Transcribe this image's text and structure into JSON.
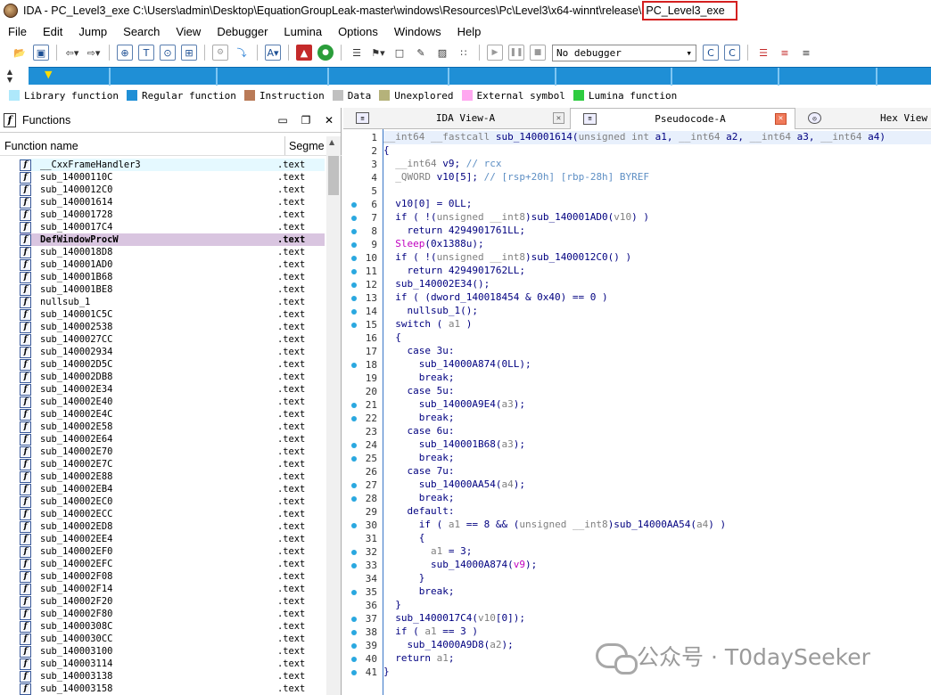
{
  "window": {
    "title_prefix": "IDA - PC_Level3_exe C:\\Users\\admin\\Desktop\\EquationGroupLeak-master\\windows\\Resources\\Pc\\Level3\\x64-winnt\\release\\",
    "title_highlight": "PC_Level3_exe"
  },
  "menu": [
    "File",
    "Edit",
    "Jump",
    "Search",
    "View",
    "Debugger",
    "Lumina",
    "Options",
    "Windows",
    "Help"
  ],
  "toolbar": {
    "debugger_select": "No debugger"
  },
  "legend": [
    {
      "label": "Library function",
      "color": "#aee8fb"
    },
    {
      "label": "Regular function",
      "color": "#1f8fd6"
    },
    {
      "label": "Instruction",
      "color": "#b97a57"
    },
    {
      "label": "Data",
      "color": "#c0c0c0"
    },
    {
      "label": "Unexplored",
      "color": "#b5b27a"
    },
    {
      "label": "External symbol",
      "color": "#ffa8f0"
    },
    {
      "label": "Lumina function",
      "color": "#2ecc40"
    }
  ],
  "functions_panel": {
    "title": "Functions",
    "col_name": "Function name",
    "col_segment": "Segme",
    "rows": [
      {
        "name": "__CxxFrameHandler3",
        "seg": ".text",
        "style": "lib"
      },
      {
        "name": "sub_14000110C",
        "seg": ".text"
      },
      {
        "name": "sub_1400012C0",
        "seg": ".text"
      },
      {
        "name": "sub_140001614",
        "seg": ".text"
      },
      {
        "name": "sub_140001728",
        "seg": ".text"
      },
      {
        "name": "sub_1400017C4",
        "seg": ".text"
      },
      {
        "name": "DefWindowProcW",
        "seg": ".text",
        "style": "sel"
      },
      {
        "name": "sub_1400018D8",
        "seg": ".text"
      },
      {
        "name": "sub_140001AD0",
        "seg": ".text"
      },
      {
        "name": "sub_140001B68",
        "seg": ".text"
      },
      {
        "name": "sub_140001BE8",
        "seg": ".text"
      },
      {
        "name": "nullsub_1",
        "seg": ".text"
      },
      {
        "name": "sub_140001C5C",
        "seg": ".text"
      },
      {
        "name": "sub_140002538",
        "seg": ".text"
      },
      {
        "name": "sub_1400027CC",
        "seg": ".text"
      },
      {
        "name": "sub_140002934",
        "seg": ".text"
      },
      {
        "name": "sub_140002D5C",
        "seg": ".text"
      },
      {
        "name": "sub_140002DB8",
        "seg": ".text"
      },
      {
        "name": "sub_140002E34",
        "seg": ".text"
      },
      {
        "name": "sub_140002E40",
        "seg": ".text"
      },
      {
        "name": "sub_140002E4C",
        "seg": ".text"
      },
      {
        "name": "sub_140002E58",
        "seg": ".text"
      },
      {
        "name": "sub_140002E64",
        "seg": ".text"
      },
      {
        "name": "sub_140002E70",
        "seg": ".text"
      },
      {
        "name": "sub_140002E7C",
        "seg": ".text"
      },
      {
        "name": "sub_140002E88",
        "seg": ".text"
      },
      {
        "name": "sub_140002EB4",
        "seg": ".text"
      },
      {
        "name": "sub_140002EC0",
        "seg": ".text"
      },
      {
        "name": "sub_140002ECC",
        "seg": ".text"
      },
      {
        "name": "sub_140002ED8",
        "seg": ".text"
      },
      {
        "name": "sub_140002EE4",
        "seg": ".text"
      },
      {
        "name": "sub_140002EF0",
        "seg": ".text"
      },
      {
        "name": "sub_140002EFC",
        "seg": ".text"
      },
      {
        "name": "sub_140002F08",
        "seg": ".text"
      },
      {
        "name": "sub_140002F14",
        "seg": ".text"
      },
      {
        "name": "sub_140002F20",
        "seg": ".text"
      },
      {
        "name": "sub_140002F80",
        "seg": ".text"
      },
      {
        "name": "sub_14000308C",
        "seg": ".text"
      },
      {
        "name": "sub_1400030CC",
        "seg": ".text"
      },
      {
        "name": "sub_140003100",
        "seg": ".text"
      },
      {
        "name": "sub_140003114",
        "seg": ".text"
      },
      {
        "name": "sub_140003138",
        "seg": ".text"
      },
      {
        "name": "sub_140003158",
        "seg": ".text"
      }
    ]
  },
  "tabs": [
    {
      "label": "IDA View-A",
      "active": false
    },
    {
      "label": "Pseudocode-A",
      "active": true
    },
    {
      "label": "Hex View",
      "active": false
    }
  ],
  "code_lines": [
    {
      "n": "1",
      "dot": false,
      "html": "<span class=\"gray\">__int64 __fastcall</span> sub_140001614(<span class=\"gray\">unsigned int</span> a1, <span class=\"gray\">__int64</span> a2, <span class=\"gray\">__int64</span> a3, <span class=\"gray\">__int64</span> a4)"
    },
    {
      "n": "2",
      "dot": false,
      "html": "{"
    },
    {
      "n": "3",
      "dot": false,
      "html": "  <span class=\"gray\">__int64</span> v9; <span class=\"cmt\">// rcx</span>"
    },
    {
      "n": "4",
      "dot": false,
      "html": "  <span class=\"gray\">_QWORD</span> v10[5]; <span class=\"cmt\">// [rsp+20h] [rbp-28h] BYREF</span>"
    },
    {
      "n": "5",
      "dot": false,
      "html": ""
    },
    {
      "n": "6",
      "dot": true,
      "html": "  v10[0] = 0LL;"
    },
    {
      "n": "7",
      "dot": true,
      "html": "  if ( !(<span class=\"gray\">unsigned __int8</span>)sub_140001AD0(<span class=\"gray\">v10</span>) )"
    },
    {
      "n": "8",
      "dot": true,
      "html": "    return 4294901761LL;"
    },
    {
      "n": "9",
      "dot": true,
      "html": "  <span class=\"pink\">Sleep</span>(0x1388u);"
    },
    {
      "n": "10",
      "dot": true,
      "html": "  if ( !(<span class=\"gray\">unsigned __int8</span>)sub_1400012C0() )"
    },
    {
      "n": "11",
      "dot": true,
      "html": "    return 4294901762LL;"
    },
    {
      "n": "12",
      "dot": true,
      "html": "  sub_140002E34();"
    },
    {
      "n": "13",
      "dot": true,
      "html": "  if ( (dword_140018454 & 0x40) == 0 )"
    },
    {
      "n": "14",
      "dot": true,
      "html": "    nullsub_1();"
    },
    {
      "n": "15",
      "dot": true,
      "html": "  switch ( <span class=\"gray\">a1</span> )"
    },
    {
      "n": "16",
      "dot": false,
      "html": "  {"
    },
    {
      "n": "17",
      "dot": false,
      "html": "    case 3u:"
    },
    {
      "n": "18",
      "dot": true,
      "html": "      sub_14000A874(0LL);"
    },
    {
      "n": "19",
      "dot": false,
      "html": "      break;"
    },
    {
      "n": "20",
      "dot": false,
      "html": "    case 5u:"
    },
    {
      "n": "21",
      "dot": true,
      "html": "      sub_14000A9E4(<span class=\"gray\">a3</span>);"
    },
    {
      "n": "22",
      "dot": true,
      "html": "      break;"
    },
    {
      "n": "23",
      "dot": false,
      "html": "    case 6u:"
    },
    {
      "n": "24",
      "dot": true,
      "html": "      sub_140001B68(<span class=\"gray\">a3</span>);"
    },
    {
      "n": "25",
      "dot": true,
      "html": "      break;"
    },
    {
      "n": "26",
      "dot": false,
      "html": "    case 7u:"
    },
    {
      "n": "27",
      "dot": true,
      "html": "      sub_14000AA54(<span class=\"gray\">a4</span>);"
    },
    {
      "n": "28",
      "dot": true,
      "html": "      break;"
    },
    {
      "n": "29",
      "dot": false,
      "html": "    default:"
    },
    {
      "n": "30",
      "dot": true,
      "html": "      if ( <span class=\"gray\">a1</span> == 8 &amp;&amp; (<span class=\"gray\">unsigned __int8</span>)sub_14000AA54(<span class=\"gray\">a4</span>) )"
    },
    {
      "n": "31",
      "dot": false,
      "html": "      {"
    },
    {
      "n": "32",
      "dot": true,
      "html": "        <span class=\"gray\">a1</span> = 3;"
    },
    {
      "n": "33",
      "dot": true,
      "html": "        sub_14000A874(<span class=\"pink\">v9</span>);"
    },
    {
      "n": "34",
      "dot": false,
      "html": "      }"
    },
    {
      "n": "35",
      "dot": true,
      "html": "      break;"
    },
    {
      "n": "36",
      "dot": false,
      "html": "  }"
    },
    {
      "n": "37",
      "dot": true,
      "html": "  sub_1400017C4(<span class=\"gray\">v10</span>[0]);"
    },
    {
      "n": "38",
      "dot": true,
      "html": "  if ( <span class=\"gray\">a1</span> == 3 )"
    },
    {
      "n": "39",
      "dot": true,
      "html": "    sub_14000A9D8(<span class=\"gray\">a2</span>);"
    },
    {
      "n": "40",
      "dot": true,
      "html": "  return <span class=\"gray\">a1</span>;"
    },
    {
      "n": "41",
      "dot": true,
      "html": "}"
    }
  ],
  "watermark": "公众号 · T0daySeeker"
}
